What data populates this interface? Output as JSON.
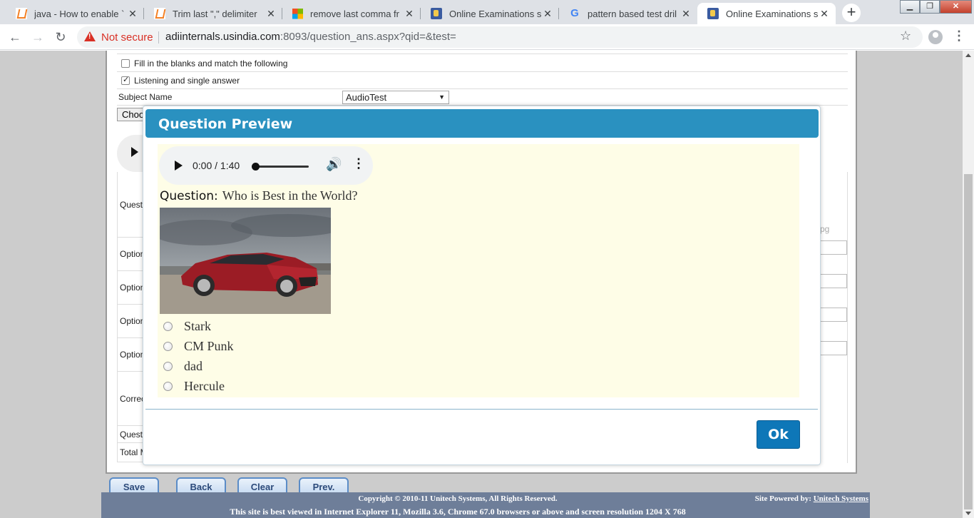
{
  "browser": {
    "tabs": [
      {
        "title": "java - How to enable `",
        "icon": "stackoverflow-icon"
      },
      {
        "title": "Trim last \",\" delimiter",
        "icon": "stackoverflow-icon"
      },
      {
        "title": "remove last comma fr",
        "icon": "microsoft-icon"
      },
      {
        "title": "Online Examinations s",
        "icon": "unitech-icon"
      },
      {
        "title": "pattern based test dril",
        "icon": "google-icon"
      },
      {
        "title": "Online Examinations s",
        "icon": "unitech-icon"
      }
    ],
    "new_tab": "+",
    "not_secure": "Not secure",
    "url_host": "adiinternals.usindia.com",
    "url_rest": ":8093/question_ans.aspx?qid=&test=",
    "window_controls": {
      "minimize": "▁",
      "maximize": "❐",
      "close": "✕"
    }
  },
  "form": {
    "fill_blanks_label": "Fill in the blanks and match the following",
    "listening_label": "Listening and single answer",
    "subject_name_label": "Subject Name",
    "subject_value": "AudioTest",
    "choose_label": "Choo",
    "question_label": "Questi",
    "option_label": "Option",
    "correct_label": "Correc",
    "question2_label": "Questi",
    "total_label": "Total M",
    "jpg_text": "pg"
  },
  "buttons": {
    "save": "Save",
    "back": "Back",
    "clear": "Clear",
    "prev": "Prev."
  },
  "footer": {
    "copyright": "Copyright © 2010-11 Unitech Systems, All Rights Reserved.",
    "best_viewed": "This site is best viewed in Internet Explorer 11, Mozilla 3.6, Chrome 67.0 browsers or above and screen resolution 1204 X 768",
    "powered_by_label": "Site Powered by:",
    "powered_by_link": "Unitech Systems"
  },
  "modal": {
    "title": "Question Preview",
    "audio": {
      "time": "0:00 / 1:40",
      "progress": 0
    },
    "question_label": "Question:",
    "question_text": "Who is Best in the World?",
    "options": [
      "Stark",
      "CM Punk",
      "dad",
      "Hercule"
    ],
    "ok": "Ok"
  },
  "colors": {
    "modal_header": "#2a91c0",
    "modal_body": "#fefde7",
    "ok_button": "#0e77b8",
    "footer": "#6e7e99",
    "not_secure": "#d93025"
  }
}
